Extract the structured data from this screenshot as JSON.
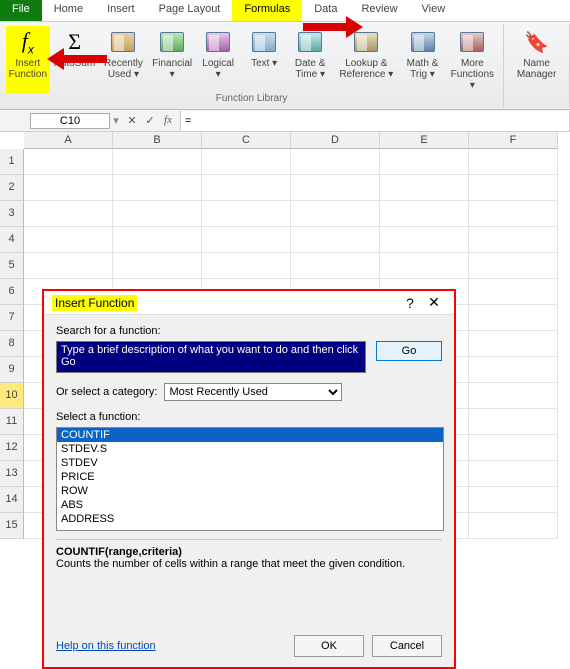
{
  "tabs": {
    "file": "File",
    "home": "Home",
    "insert": "Insert",
    "pagelayout": "Page Layout",
    "formulas": "Formulas",
    "data": "Data",
    "review": "Review",
    "view": "View"
  },
  "ribbon": {
    "insertfn": "Insert\nFunction",
    "autosum": "AutoSum",
    "recent": "Recently\nUsed ▾",
    "financial": "Financial\n▾",
    "logical": "Logical\n▾",
    "text": "Text\n▾",
    "datetime": "Date &\nTime ▾",
    "lookup": "Lookup &\nReference ▾",
    "math": "Math\n& Trig ▾",
    "more": "More\nFunctions ▾",
    "namemgr": "Name\nManager",
    "grouplabel": "Function Library"
  },
  "fbar": {
    "name": "C10",
    "value": "="
  },
  "cols": [
    "A",
    "B",
    "C",
    "D",
    "E",
    "F"
  ],
  "rows": [
    "1",
    "2",
    "3",
    "4",
    "5",
    "6",
    "7",
    "8",
    "9",
    "10",
    "11",
    "12",
    "13",
    "14",
    "15"
  ],
  "dialog": {
    "title": "Insert Function",
    "searchlbl": "Search for a function:",
    "searchtext": "Type a brief description of what you want to do and then click Go",
    "go": "Go",
    "catlbl": "Or select a category:",
    "catval": "Most Recently Used",
    "selectlbl": "Select a function:",
    "funcs": [
      "COUNTIF",
      "STDEV.S",
      "STDEV",
      "PRICE",
      "ROW",
      "ABS",
      "ADDRESS"
    ],
    "sig": "COUNTIF(range,criteria)",
    "desc": "Counts the number of cells within a range that meet the given condition.",
    "help": "Help on this function",
    "ok": "OK",
    "cancel": "Cancel"
  }
}
